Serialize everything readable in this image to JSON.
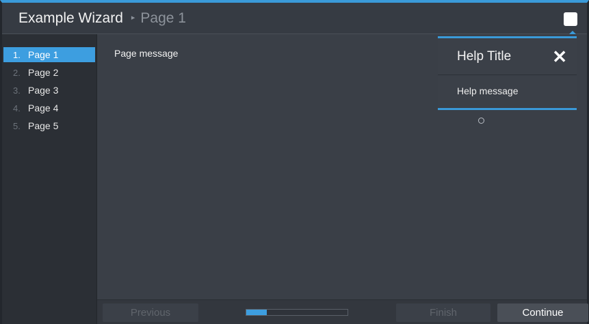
{
  "window": {
    "title": "Example Wizard",
    "breadcrumb_separator": "▸",
    "breadcrumb_current": "Page 1",
    "accent_color": "#3a9ad9"
  },
  "sidebar": {
    "steps": [
      {
        "number": "1.",
        "label": "Page 1"
      },
      {
        "number": "2.",
        "label": "Page 2"
      },
      {
        "number": "3.",
        "label": "Page 3"
      },
      {
        "number": "4.",
        "label": "Page 4"
      },
      {
        "number": "5.",
        "label": "Page 5"
      }
    ],
    "active_index": 0
  },
  "content": {
    "message": "Page message"
  },
  "help": {
    "toggle_icon": "help-toggle-icon",
    "title": "Help Title",
    "close_glyph": "✕",
    "message": "Help message"
  },
  "footer": {
    "previous_label": "Previous",
    "finish_label": "Finish",
    "continue_label": "Continue",
    "progress_fraction": 0.2
  }
}
